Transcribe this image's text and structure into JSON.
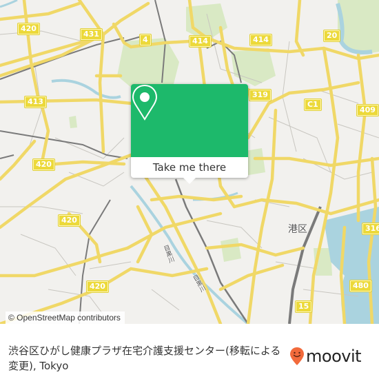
{
  "map": {
    "route_shields": [
      {
        "id": "420-a",
        "label": "420"
      },
      {
        "id": "431",
        "label": "431"
      },
      {
        "id": "4",
        "label": "4"
      },
      {
        "id": "414-a",
        "label": "414"
      },
      {
        "id": "414-b",
        "label": "414"
      },
      {
        "id": "20",
        "label": "20"
      },
      {
        "id": "413",
        "label": "413"
      },
      {
        "id": "319",
        "label": "319"
      },
      {
        "id": "C1",
        "label": "C1"
      },
      {
        "id": "409",
        "label": "409"
      },
      {
        "id": "420-b",
        "label": "420"
      },
      {
        "id": "420-c",
        "label": "420"
      },
      {
        "id": "420-d",
        "label": "420"
      },
      {
        "id": "316",
        "label": "316"
      },
      {
        "id": "480",
        "label": "480"
      },
      {
        "id": "15",
        "label": "15"
      }
    ],
    "district_label": "港区",
    "river_labels": [
      "目黒川",
      "目黒川"
    ],
    "colors": {
      "background": "#f2f1ee",
      "major_road": "#f6e27a",
      "park": "#d6e8c0",
      "water": "#aad3df",
      "rail": "#777777"
    }
  },
  "popup": {
    "icon": "map-pin-icon",
    "button_label": "Take me there",
    "color": "#1db96b"
  },
  "attribution": "© OpenStreetMap contributors",
  "footer": {
    "title": "渋谷区ひがし健康プラザ在宅介護支援センター(移転による変更), Tokyo",
    "brand": "moovit",
    "brand_color": "#f26a3b"
  }
}
